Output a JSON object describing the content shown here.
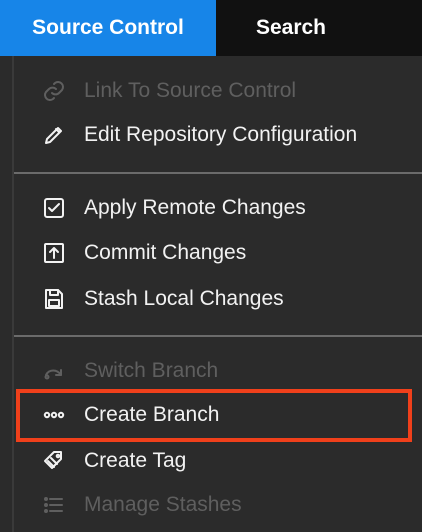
{
  "tabs": {
    "source_control": "Source Control",
    "search": "Search"
  },
  "menu": {
    "items": [
      {
        "label": "Link To Source Control",
        "icon": "link-icon",
        "disabled": true
      },
      {
        "label": "Edit Repository Configuration",
        "icon": "pencil-icon",
        "disabled": false
      },
      {
        "label": "Apply Remote Changes",
        "icon": "checkbox-icon",
        "disabled": false
      },
      {
        "label": "Commit Changes",
        "icon": "upload-box-icon",
        "disabled": false
      },
      {
        "label": "Stash Local Changes",
        "icon": "save-icon",
        "disabled": false
      },
      {
        "label": "Switch Branch",
        "icon": "switch-branch-icon",
        "disabled": true
      },
      {
        "label": "Create Branch",
        "icon": "dots-icon",
        "disabled": false
      },
      {
        "label": "Create Tag",
        "icon": "tag-icon",
        "disabled": false
      },
      {
        "label": "Manage Stashes",
        "icon": "list-icon",
        "disabled": true
      }
    ]
  },
  "colors": {
    "accent": "#1785e8",
    "highlight": "#f0401b",
    "enabled_text": "#f2f2f2",
    "disabled_text": "#5f5f5f"
  }
}
